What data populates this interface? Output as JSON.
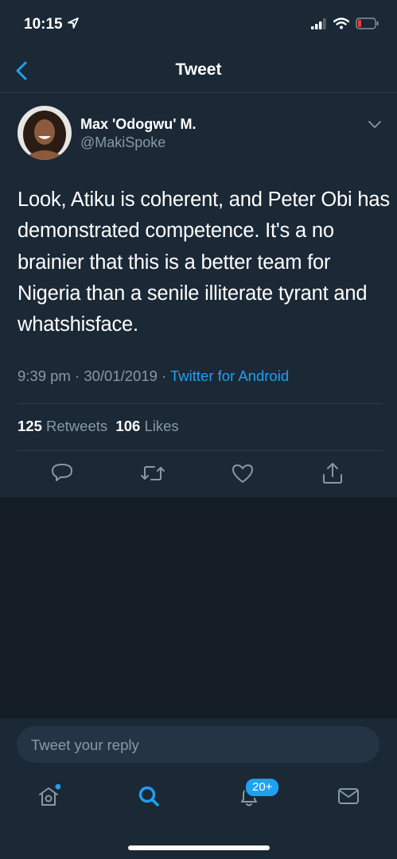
{
  "status_bar": {
    "time": "10:15"
  },
  "nav": {
    "title": "Tweet"
  },
  "user": {
    "name": "Max 'Odogwu' M.",
    "handle": "@MakiSpoke"
  },
  "tweet": {
    "text": "Look, Atiku is coherent, and Peter Obi has demonstrated competence. It's a no brainier that this is a better team for Nigeria than a senile illiterate tyrant and whatshisface.",
    "time": "9:39 pm",
    "date": "30/01/2019",
    "separator": " · ",
    "source": "Twitter for Android"
  },
  "stats": {
    "retweets_count": "125",
    "retweets_label": "Retweets",
    "likes_count": "106",
    "likes_label": "Likes"
  },
  "actions": [
    "reply-icon",
    "retweet-icon",
    "like-icon",
    "share-icon"
  ],
  "reply": {
    "placeholder": "Tweet your reply"
  },
  "tabs": [
    "home-icon",
    "search-icon",
    "notifications-icon",
    "messages-icon"
  ],
  "notifications": {
    "badge": "20+"
  },
  "colors": {
    "accent": "#1da1f2",
    "background": "#141d26",
    "surface": "#1b2836",
    "secondary_text": "#8899a6"
  }
}
